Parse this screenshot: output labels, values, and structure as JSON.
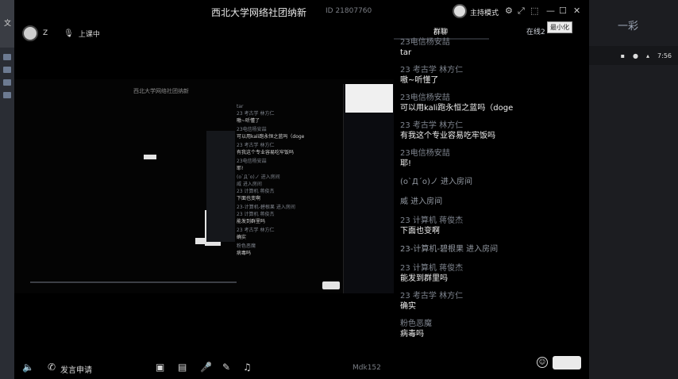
{
  "desktop": {
    "left_label": "文",
    "right_extra": "一彩",
    "right_time": "7:56"
  },
  "window": {
    "title": "西北大学网络社团纳新",
    "room_id": "ID 21807760",
    "host_mode": "主持模式",
    "tooltip": "最小化",
    "user_name": "Z",
    "class_status": "上课中"
  },
  "tabs": {
    "chat": "群聊",
    "online": "在线2"
  },
  "messages": [
    {
      "type": "msg",
      "name": "23电信杨安喆",
      "text": "tar"
    },
    {
      "type": "msg",
      "name": "23 考古学 林方仁",
      "text": "嗷~听懂了"
    },
    {
      "type": "msg",
      "name": "23电信杨安喆",
      "text": "可以用kali跑永恒之蓝吗（doge"
    },
    {
      "type": "msg",
      "name": "23 考古学 林方仁",
      "text": "有我这个专业容易吃牢饭吗"
    },
    {
      "type": "msg",
      "name": "23电信杨安喆",
      "text": "耶!"
    },
    {
      "type": "sys",
      "text": "(o`Д´o)ノ 进入房间"
    },
    {
      "type": "sys",
      "text": "威 进入房间"
    },
    {
      "type": "msg",
      "name": "23 计算机 蒋俊杰",
      "text": "下面也变啊"
    },
    {
      "type": "sys",
      "text": "23-计算机-碧根果 进入房间"
    },
    {
      "type": "msg",
      "name": "23 计算机 蒋俊杰",
      "text": "能发到群里吗"
    },
    {
      "type": "msg",
      "name": "23 考古学 林方仁",
      "text": "确实"
    },
    {
      "type": "msg",
      "name": "粉色恶魔",
      "text": "病毒吗"
    }
  ],
  "bottom": {
    "apply_label": "发言申请",
    "page": "Mdk152"
  },
  "icons": [
    "minimize-icon",
    "maximize-icon",
    "close-icon",
    "settings-icon",
    "speaker-icon",
    "phone-icon",
    "camera-off-icon",
    "screen-share-icon",
    "mic-icon",
    "edit-icon",
    "music-icon",
    "emoji-icon"
  ],
  "shared": {
    "title": "西北大学网络社团纳新",
    "chat": [
      {
        "name": "tar",
        "text": ""
      },
      {
        "name": "23 考古学 林方仁",
        "text": "嗷~听懂了"
      },
      {
        "name": "23电信杨安喆",
        "text": "可以用kali跑永恒之蓝吗（doge"
      },
      {
        "name": "23 考古学 林方仁",
        "text": "有我这个专业容易吃牢饭吗"
      },
      {
        "name": "23电信杨安喆",
        "text": "耶!"
      },
      {
        "name": "(o`Д´o)ノ 进入房间",
        "text": ""
      },
      {
        "name": "威 进入房间",
        "text": ""
      },
      {
        "name": "23 计算机 蒋俊杰",
        "text": "下面也变啊"
      },
      {
        "name": "23-计算机-碧根果 进入房间",
        "text": ""
      },
      {
        "name": "23 计算机 蒋俊杰",
        "text": "能发到群里吗"
      },
      {
        "name": "23 考古学 林方仁",
        "text": "确实"
      },
      {
        "name": "粉色恶魔",
        "text": "病毒吗"
      }
    ]
  }
}
